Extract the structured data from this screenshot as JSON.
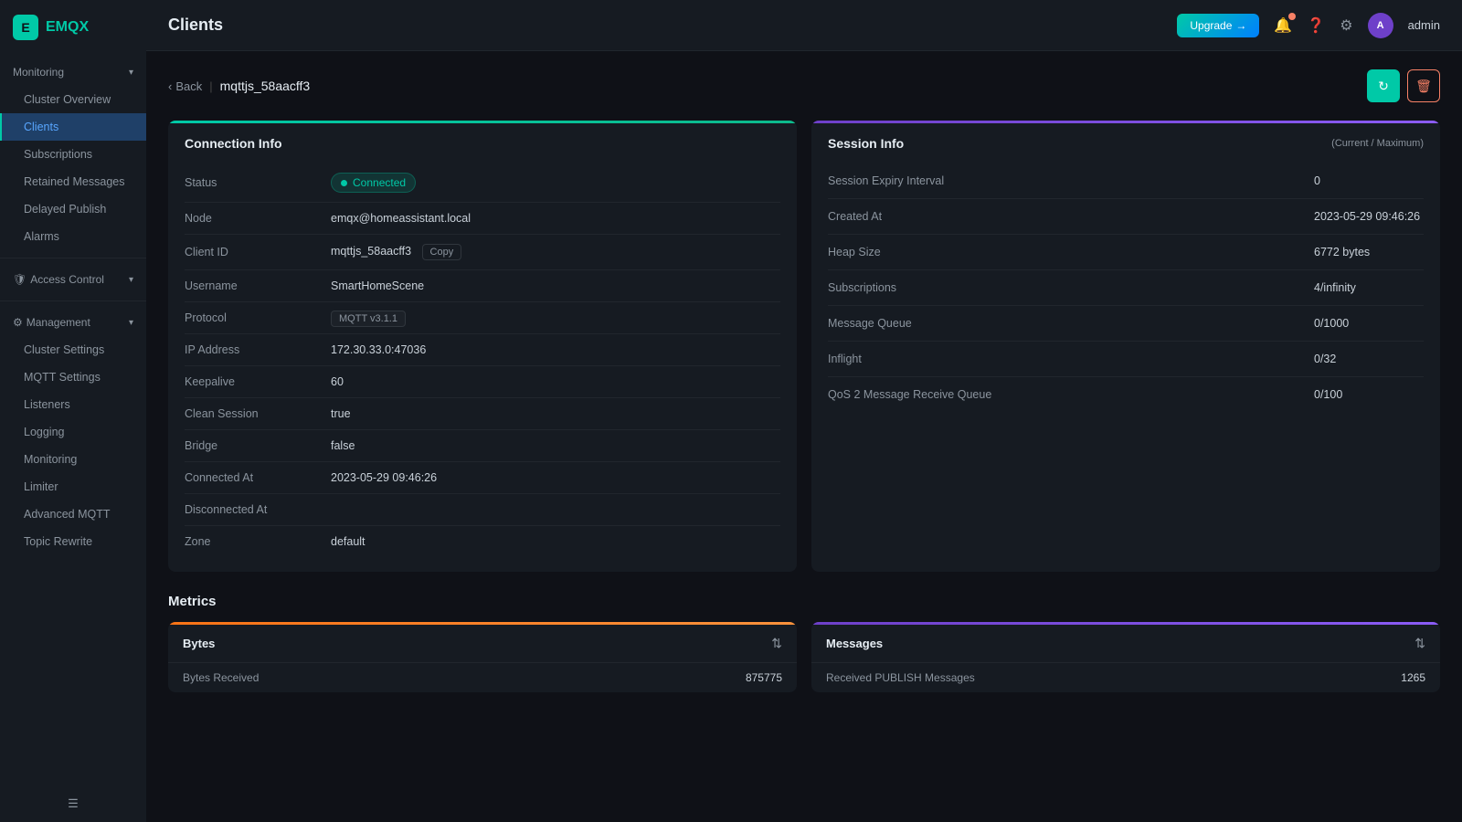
{
  "app": {
    "name": "EMQX",
    "logo_text": "E"
  },
  "header": {
    "title": "Clients",
    "upgrade_label": "Upgrade",
    "admin_label": "admin"
  },
  "breadcrumb": {
    "back_label": "Back",
    "current": "mqttjs_58aacff3"
  },
  "sidebar": {
    "monitoring_label": "Monitoring",
    "management_label": "Management",
    "access_control_label": "Access Control",
    "items_monitoring": [
      {
        "label": "Cluster Overview",
        "active": false
      },
      {
        "label": "Clients",
        "active": true
      },
      {
        "label": "Subscriptions",
        "active": false
      },
      {
        "label": "Retained Messages",
        "active": false
      },
      {
        "label": "Delayed Publish",
        "active": false
      },
      {
        "label": "Alarms",
        "active": false
      }
    ],
    "items_access": [
      {
        "label": "Access Control",
        "active": false
      }
    ],
    "items_management": [
      {
        "label": "Cluster Settings",
        "active": false
      },
      {
        "label": "MQTT Settings",
        "active": false
      },
      {
        "label": "Listeners",
        "active": false
      },
      {
        "label": "Logging",
        "active": false
      },
      {
        "label": "Monitoring",
        "active": false
      },
      {
        "label": "Limiter",
        "active": false
      },
      {
        "label": "Advanced MQTT",
        "active": false
      },
      {
        "label": "Topic Rewrite",
        "active": false
      }
    ]
  },
  "connection_info": {
    "title": "Connection Info",
    "status_label": "Status",
    "status_value": "Connected",
    "node_label": "Node",
    "node_value": "emqx@homeassistant.local",
    "client_id_label": "Client ID",
    "client_id_value": "mqttjs_58aacff3",
    "copy_label": "Copy",
    "username_label": "Username",
    "username_value": "SmartHomeScene",
    "protocol_label": "Protocol",
    "protocol_value": "MQTT v3.1.1",
    "ip_label": "IP Address",
    "ip_value": "172.30.33.0:47036",
    "keepalive_label": "Keepalive",
    "keepalive_value": "60",
    "clean_session_label": "Clean Session",
    "clean_session_value": "true",
    "bridge_label": "Bridge",
    "bridge_value": "false",
    "connected_at_label": "Connected At",
    "connected_at_value": "2023-05-29 09:46:26",
    "disconnected_at_label": "Disconnected At",
    "disconnected_at_value": "",
    "zone_label": "Zone",
    "zone_value": "default"
  },
  "session_info": {
    "title": "Session Info",
    "subtitle": "(Current / Maximum)",
    "rows": [
      {
        "label": "Session Expiry Interval",
        "value": "0"
      },
      {
        "label": "Created At",
        "value": "2023-05-29 09:46:26"
      },
      {
        "label": "Heap Size",
        "value": "6772 bytes"
      },
      {
        "label": "Subscriptions",
        "value": "4/infinity"
      },
      {
        "label": "Message Queue",
        "value": "0/1000"
      },
      {
        "label": "Inflight",
        "value": "0/32"
      },
      {
        "label": "QoS 2 Message Receive Queue",
        "value": "0/100"
      }
    ]
  },
  "metrics": {
    "title": "Metrics",
    "bytes_title": "Bytes",
    "messages_title": "Messages",
    "bytes_rows": [
      {
        "label": "Bytes Received",
        "value": "875775"
      }
    ],
    "messages_rows": [
      {
        "label": "Received PUBLISH Messages",
        "value": "1265"
      }
    ]
  }
}
